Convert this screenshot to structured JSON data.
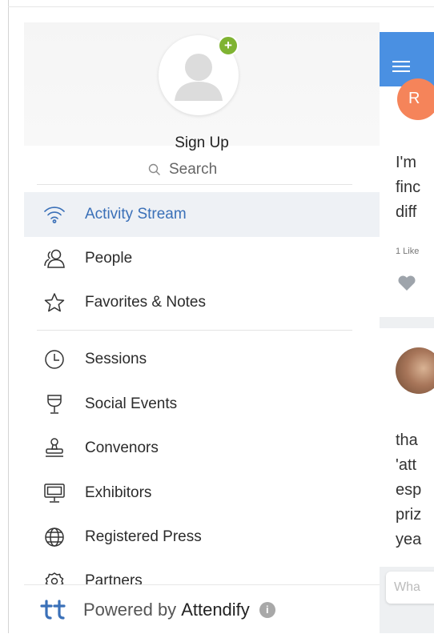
{
  "profile": {
    "sign_up_label": "Sign Up",
    "add_badge": "+"
  },
  "search": {
    "placeholder": "Search"
  },
  "menu": {
    "items": [
      {
        "label": "Activity Stream",
        "icon": "wifi-icon",
        "active": true
      },
      {
        "label": "People",
        "icon": "people-icon"
      },
      {
        "label": "Favorites & Notes",
        "icon": "star-icon"
      },
      {
        "label": "Sessions",
        "icon": "clock-icon"
      },
      {
        "label": "Social Events",
        "icon": "wine-glass-icon"
      },
      {
        "label": "Convenors",
        "icon": "stamp-icon"
      },
      {
        "label": "Exhibitors",
        "icon": "monitor-icon"
      },
      {
        "label": "Registered Press",
        "icon": "globe-icon"
      },
      {
        "label": "Partners",
        "icon": "gear-icon"
      }
    ]
  },
  "footer": {
    "powered_by": "Powered by",
    "brand": "Attendify",
    "info_icon": "i"
  },
  "background_feed": {
    "post1_initials": "R",
    "post1_lines": [
      "I'm",
      "finc",
      "diff"
    ],
    "post1_likes": "1 Like",
    "post2_lines": [
      "tha",
      "'att",
      "esp",
      "priz",
      "yea"
    ],
    "compose_placeholder": "Wha"
  },
  "colors": {
    "accent": "#3a70b8",
    "app_bar": "#4a90e2",
    "badge_green": "#7fb332",
    "avatar_orange": "#f5845a"
  }
}
